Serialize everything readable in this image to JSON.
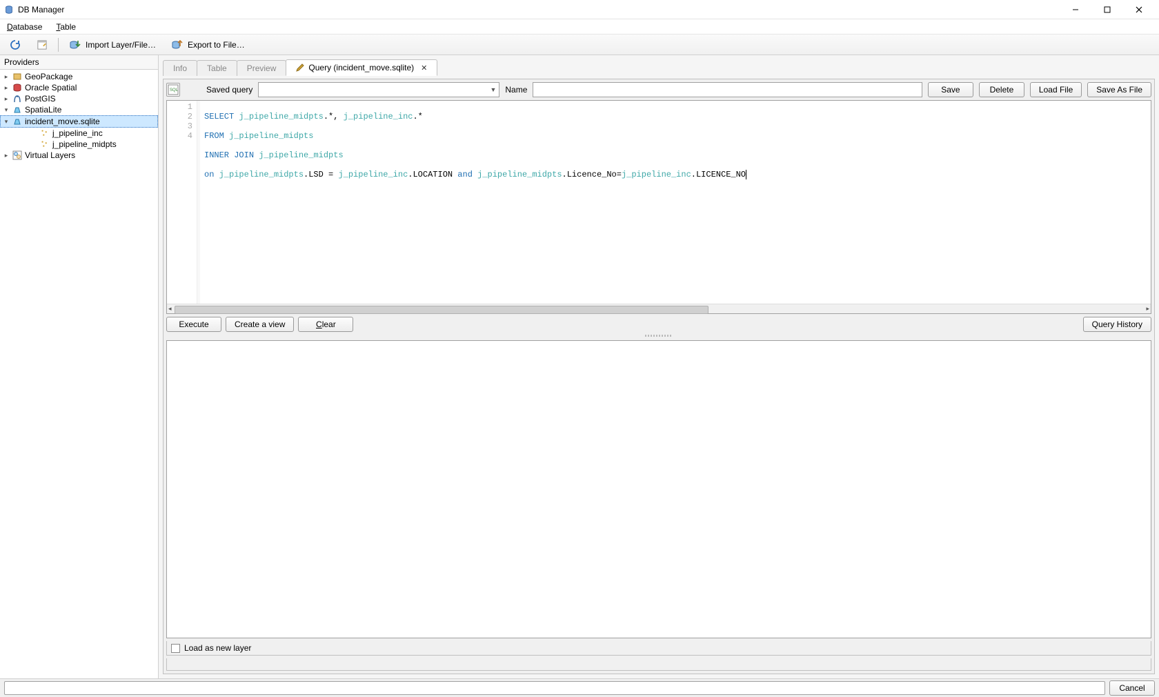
{
  "window": {
    "title": "DB Manager"
  },
  "menu": {
    "database": "Database",
    "table": "Table"
  },
  "toolbar": {
    "import_layer": "Import Layer/File…",
    "export_to_file": "Export to File…"
  },
  "sidebar": {
    "title": "Providers",
    "items": {
      "geopackage": "GeoPackage",
      "oracle": "Oracle Spatial",
      "postgis": "PostGIS",
      "spatialite": "SpatiaLite",
      "database": "incident_move.sqlite",
      "table1": "j_pipeline_inc",
      "table2": "j_pipeline_midpts",
      "virtual": "Virtual Layers"
    }
  },
  "tabs": {
    "info": "Info",
    "table": "Table",
    "preview": "Preview",
    "query": "Query (incident_move.sqlite)"
  },
  "query_bar": {
    "saved_query_label": "Saved query",
    "name_label": "Name",
    "save": "Save",
    "delete": "Delete",
    "load_file": "Load File",
    "save_as_file": "Save As File"
  },
  "sql": {
    "line1": {
      "kw1": "SELECT",
      "t1": " j_pipeline_midpts",
      "t2": ".*, ",
      "t3": "j_pipeline_inc",
      "t4": ".*"
    },
    "line2": {
      "kw1": "FROM",
      "t1": " j_pipeline_midpts"
    },
    "line3": {
      "kw1": "INNER",
      "kw2": " JOIN",
      "t1": " j_pipeline_midpts"
    },
    "line4": {
      "kw1": "on",
      "t1": " j_pipeline_midpts",
      "t2": ".LSD = ",
      "t3": "j_pipeline_inc",
      "t4": ".LOCATION ",
      "kw2": "and",
      "t5": " j_pipeline_midpts",
      "t6": ".Licence_No=",
      "t7": "j_pipeline_inc",
      "t8": ".LICENCE_NO"
    },
    "lines": [
      "1",
      "2",
      "3",
      "4"
    ]
  },
  "actions": {
    "execute": "Execute",
    "create_view": "Create a view",
    "clear": "Clear",
    "query_history": "Query History"
  },
  "load_as_layer": "Load as new layer",
  "footer": {
    "cancel": "Cancel"
  }
}
